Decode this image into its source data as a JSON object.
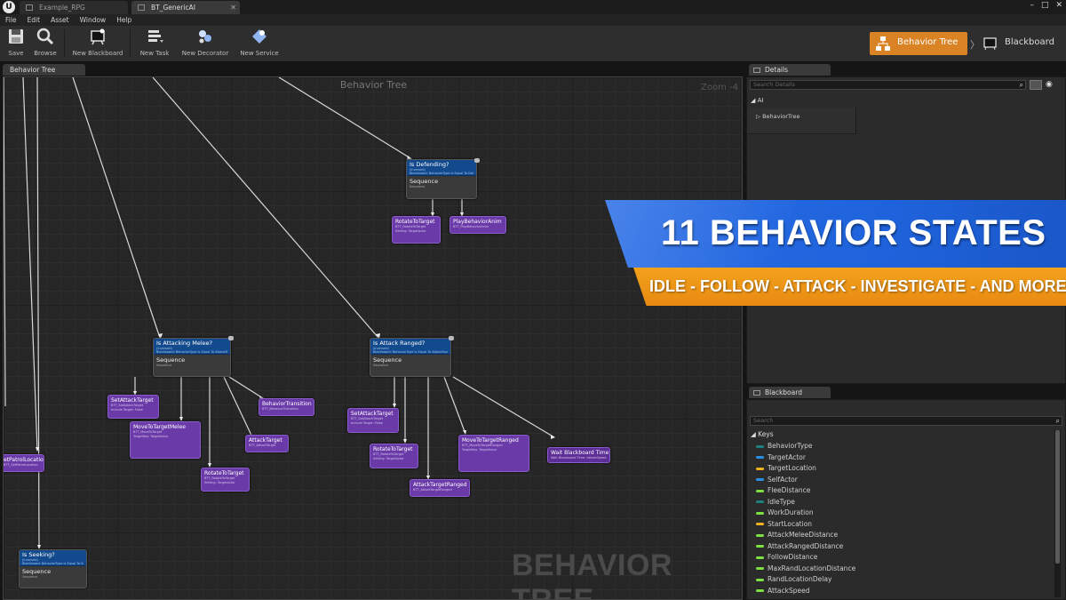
{
  "titlebar": {
    "tabs": [
      {
        "label": "Example_RPG"
      },
      {
        "label": "BT_GenericAI"
      }
    ],
    "controls": {
      "minimize": "–",
      "maximize": "□",
      "close": "✕"
    }
  },
  "menu": [
    "File",
    "Edit",
    "Asset",
    "Window",
    "Help"
  ],
  "toolbar": {
    "save": "Save",
    "browse": "Browse",
    "new_blackboard": "New Blackboard",
    "new_task": "New Task",
    "new_decorator": "New Decorator",
    "new_service": "New Service",
    "mode_behavior_tree": "Behavior Tree",
    "mode_separator": "〉",
    "mode_blackboard": "Blackboard"
  },
  "graph": {
    "tab_label": "Behavior Tree",
    "title": "Behavior Tree",
    "zoom": "Zoom -4",
    "watermark": "BEHAVIOR TREE",
    "nodes": {
      "defending": {
        "decorator": "Is Defending?",
        "sub1": "(Inversed)",
        "sub2": "Blackboard: BehaviorType is Equal To Defend",
        "composite": "Sequence",
        "csub": "Sequence"
      },
      "melee": {
        "decorator": "Is Attacking Melee?",
        "sub1": "(Inversed)",
        "sub2": "Blackboard: BehaviorType is Equal To AttackMelee",
        "composite": "Sequence",
        "csub": "Sequence"
      },
      "ranged": {
        "decorator": "Is Attack Ranged?",
        "sub1": "(Inversed)",
        "sub2": "Blackboard: BehaviorType is Equal To AttackRanged",
        "composite": "Sequence",
        "csub": "Sequence"
      },
      "seeking": {
        "decorator": "Is Seeking?",
        "sub1": "(Inversed)",
        "sub2": "Blackboard: BehaviorType is Equal To Seek",
        "composite": "Sequence",
        "csub": "Sequence"
      },
      "t_rotate_def": {
        "name": "RotateToTarget",
        "sub1": "BTT_RotateToTarget",
        "sub2": "Setting: TargetActor"
      },
      "t_playanim": {
        "name": "PlayBehaviorAnim",
        "sub1": "BTT_PlayBehaviorAnim",
        "sub2": ""
      },
      "t_setattack_m": {
        "name": "SetAttackTarget",
        "sub1": "BTT_SetAttackTarget",
        "sub2": "Include Target: False"
      },
      "t_movemelee": {
        "name": "MoveToTargetMelee",
        "sub1": "BTT_MoveToTarget",
        "sub2": "TargetKey: TargetActor"
      },
      "t_rotate_m": {
        "name": "RotateToTarget",
        "sub1": "BTT_RotateToTarget",
        "sub2": "Setting: TargetActor"
      },
      "t_attack": {
        "name": "AttackTarget",
        "sub1": "BTT_AttackTarget",
        "sub2": ""
      },
      "t_transition": {
        "name": "BehaviorTransition",
        "sub1": "BTT_BehaviorTransition",
        "sub2": ""
      },
      "t_setattack_r": {
        "name": "SetAttackTarget",
        "sub1": "BTT_SetAttackTarget",
        "sub2": "Include Target: False"
      },
      "t_rotate_r": {
        "name": "RotateToTarget",
        "sub1": "BTT_RotateToTarget",
        "sub2": "Setting: TargetActor"
      },
      "t_attackranged": {
        "name": "AttackTargetRanged",
        "sub1": "BTT_AttackTargetRanged",
        "sub2": ""
      },
      "t_moveranged": {
        "name": "MoveToTargetRanged",
        "sub1": "BTT_MoveToTargetRanged",
        "sub2": "TargetKey: TargetActor"
      },
      "t_wait": {
        "name": "Wait Blackboard Time",
        "sub1": "Wait Blackboard Time: AttackSpeed",
        "sub2": ""
      },
      "t_patrol": {
        "name": "etPatrolLocation",
        "sub1": "BTT_SetPatrolLocation",
        "sub2": ""
      }
    }
  },
  "banner": {
    "title": "11 BEHAVIOR STATES",
    "subtitle": "IDLE - FOLLOW - ATTACK - INVESTIGATE - AND MORE",
    "colors": {
      "blue": "#1f63dc",
      "orange": "#f0971a"
    }
  },
  "details": {
    "tab_label": "Details",
    "search_placeholder": "Search Details",
    "category": "◢ AI",
    "row": "▷ BehaviorTree"
  },
  "blackboard": {
    "tab_label": "Blackboard",
    "search_placeholder": "Search",
    "keys_header": "◢ Keys",
    "keys": [
      {
        "name": "BehaviorType",
        "color": "#1f7f7f"
      },
      {
        "name": "TargetActor",
        "color": "#2a8fe0"
      },
      {
        "name": "TargetLocation",
        "color": "#f0b020"
      },
      {
        "name": "SelfActor",
        "color": "#2a8fe0"
      },
      {
        "name": "FleeDistance",
        "color": "#7ce040"
      },
      {
        "name": "IdleType",
        "color": "#1f7f7f"
      },
      {
        "name": "WorkDuration",
        "color": "#7ce040"
      },
      {
        "name": "StartLocation",
        "color": "#f0b020"
      },
      {
        "name": "AttackMeleeDistance",
        "color": "#7ce040"
      },
      {
        "name": "AttackRangedDistance",
        "color": "#7ce040"
      },
      {
        "name": "FollowDistance",
        "color": "#7ce040"
      },
      {
        "name": "MaxRandLocationDistance",
        "color": "#7ce040"
      },
      {
        "name": "RandLocationDelay",
        "color": "#7ce040"
      },
      {
        "name": "AttackSpeed",
        "color": "#7ce040"
      }
    ]
  }
}
